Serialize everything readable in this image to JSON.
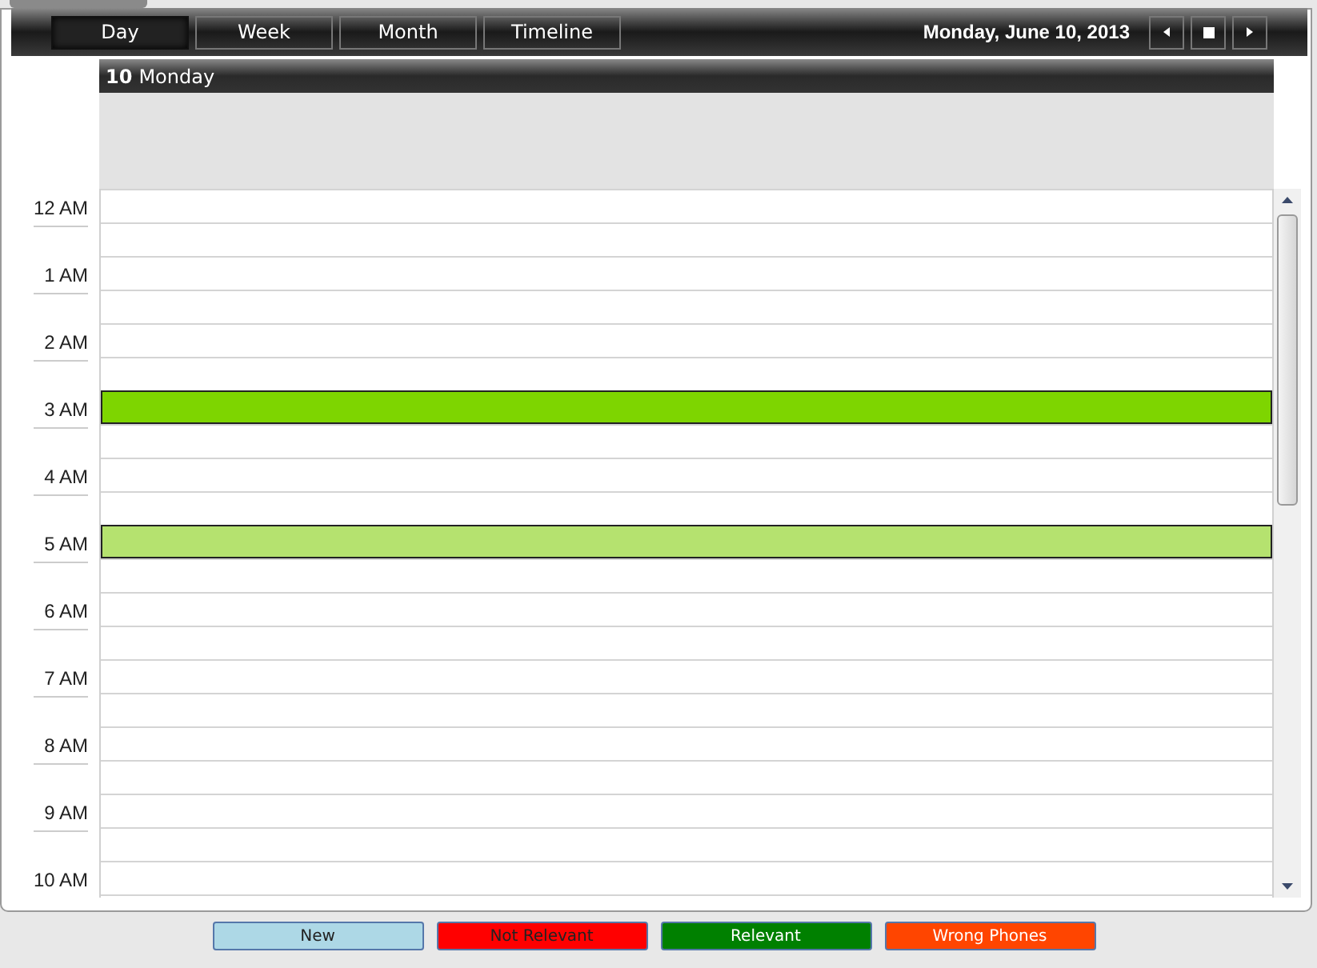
{
  "toolbar": {
    "views": [
      {
        "label": "Day",
        "selected": true
      },
      {
        "label": "Week",
        "selected": false
      },
      {
        "label": "Month",
        "selected": false
      },
      {
        "label": "Timeline",
        "selected": false
      }
    ],
    "date": "Monday, June 10, 2013"
  },
  "day_header": {
    "number": "10",
    "weekday": "Monday"
  },
  "hours": [
    {
      "label": "12 AM"
    },
    {
      "label": "1 AM"
    },
    {
      "label": "2 AM"
    },
    {
      "label": "3 AM",
      "event": {
        "color": "#7ed500"
      }
    },
    {
      "label": "4 AM"
    },
    {
      "label": "5 AM",
      "event": {
        "color": "#b5e26f"
      }
    },
    {
      "label": "6 AM"
    },
    {
      "label": "7 AM"
    },
    {
      "label": "8 AM"
    },
    {
      "label": "9 AM"
    },
    {
      "label": "10 AM"
    }
  ],
  "legend": [
    {
      "label": "New",
      "color": "#add8e6",
      "kind": "dark_text"
    },
    {
      "label": "Not Relevant",
      "color": "#ff0000",
      "kind": "dark_text"
    },
    {
      "label": "Relevant",
      "color": "#008000",
      "kind": "light_text"
    },
    {
      "label": "Wrong Phones",
      "color": "#ff4500",
      "kind": "light_text"
    }
  ]
}
